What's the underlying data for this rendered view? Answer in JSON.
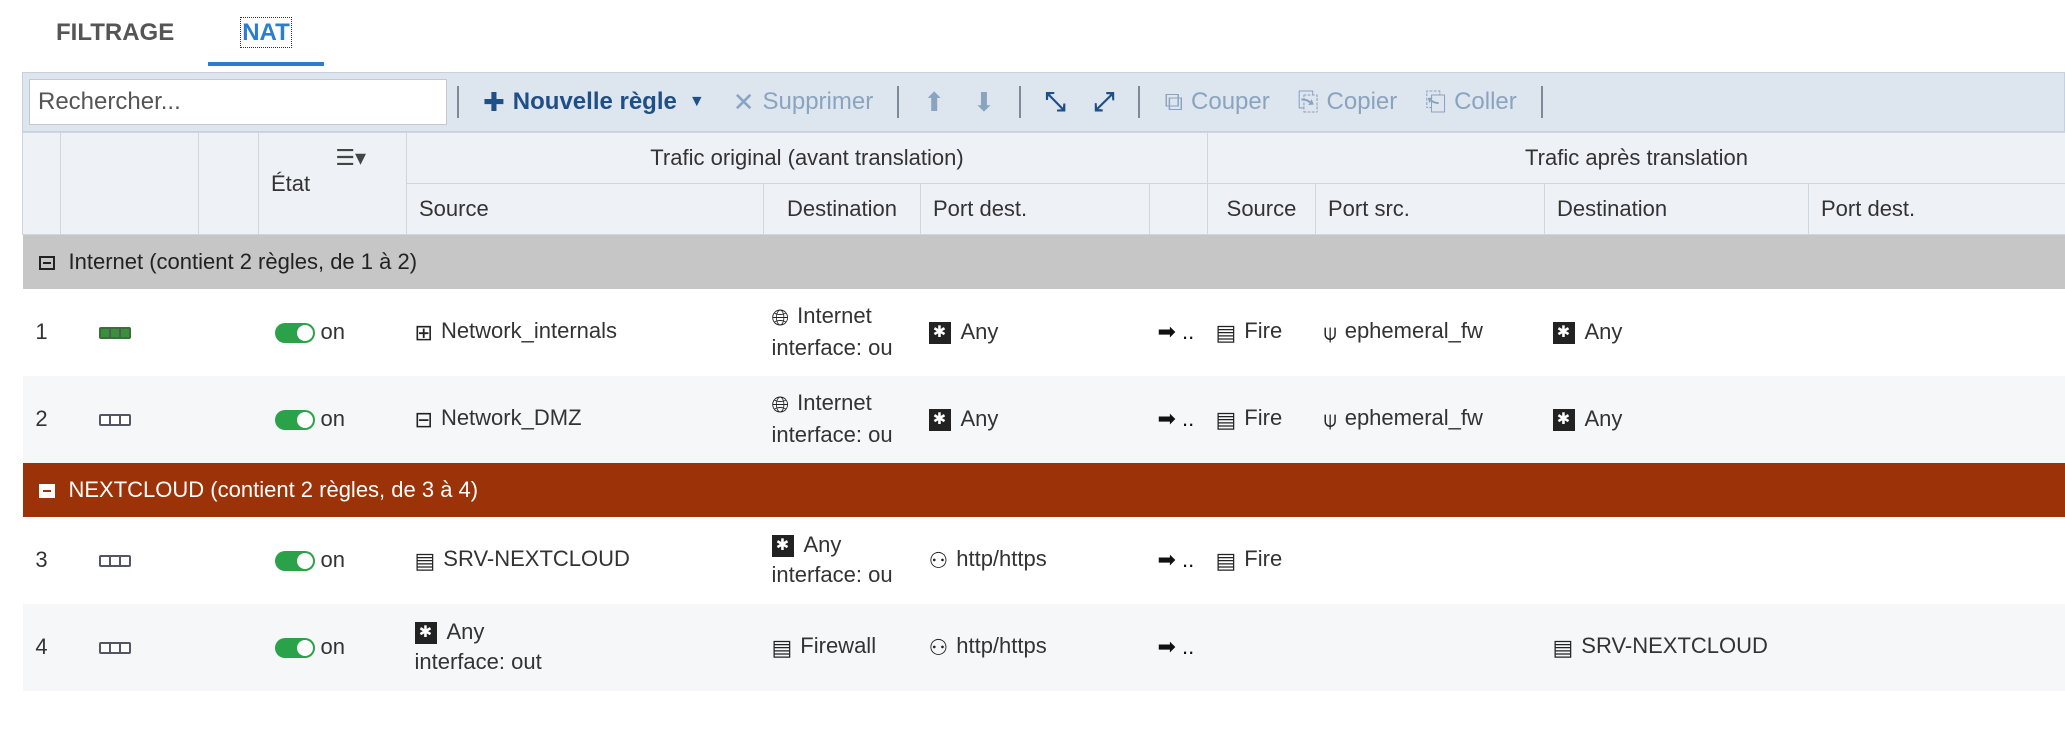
{
  "tabs": [
    {
      "label": "FILTRAGE"
    },
    {
      "label": "NAT"
    }
  ],
  "toolbar": {
    "search_placeholder": "Rechercher...",
    "new_rule": "Nouvelle règle",
    "delete": "Supprimer",
    "cut": "Couper",
    "copy": "Copier",
    "paste": "Coller"
  },
  "header": {
    "etat": "État",
    "original_group": "Trafic original (avant translation)",
    "after_group": "Trafic après translation",
    "orig_source": "Source",
    "orig_destination": "Destination",
    "orig_port_dest": "Port dest.",
    "tr_source": "Source",
    "tr_port_src": "Port src.",
    "tr_destination": "Destination",
    "tr_port_dest": "Port dest."
  },
  "groups": [
    {
      "label": "Internet (contient 2 règles, de 1 à 2)",
      "color": "#c6c6c6"
    },
    {
      "label": "NEXTCLOUD (contient 2 règles, de 3 à 4)",
      "color": "#9b3208"
    }
  ],
  "rules": [
    {
      "num": "1",
      "state": "on",
      "source": "Network_internals",
      "source_icon": "network-group-icon",
      "dest_line1": "Internet",
      "dest_line2": "interface: ou",
      "dest_icon": "globe-icon",
      "port_dest": "Any",
      "arrow": "➡ ..",
      "tr_source": "Fire",
      "tr_port_src": "ephemeral_fw",
      "tr_destination": "",
      "tr_port_dest": "Any"
    },
    {
      "num": "2",
      "state": "on",
      "source": "Network_DMZ",
      "source_icon": "network-dmz-icon",
      "dest_line1": "Internet",
      "dest_line2": "interface: ou",
      "dest_icon": "globe-icon",
      "port_dest": "Any",
      "arrow": "➡ ..",
      "tr_source": "Fire",
      "tr_port_src": "ephemeral_fw",
      "tr_destination": "",
      "tr_port_dest": "Any"
    },
    {
      "num": "3",
      "state": "on",
      "source": "SRV-NEXTCLOUD",
      "source_icon": "server-icon",
      "dest_line1": "Any",
      "dest_line2": "interface: ou",
      "dest_icon": "any-icon",
      "port_dest": "http/https",
      "arrow": "➡ ..",
      "tr_source": "Fire",
      "tr_port_src": "",
      "tr_destination": "",
      "tr_port_dest": ""
    },
    {
      "num": "4",
      "state": "on",
      "source_line1": "Any",
      "source_line2": "interface: out",
      "source_icon": "any-icon",
      "dest": "Firewall",
      "dest_icon": "server-icon",
      "port_dest": "http/https",
      "arrow": "➡ ..",
      "tr_source": "",
      "tr_port_src": "",
      "tr_destination": "SRV-NEXTCLOUD",
      "tr_port_dest": ""
    }
  ]
}
